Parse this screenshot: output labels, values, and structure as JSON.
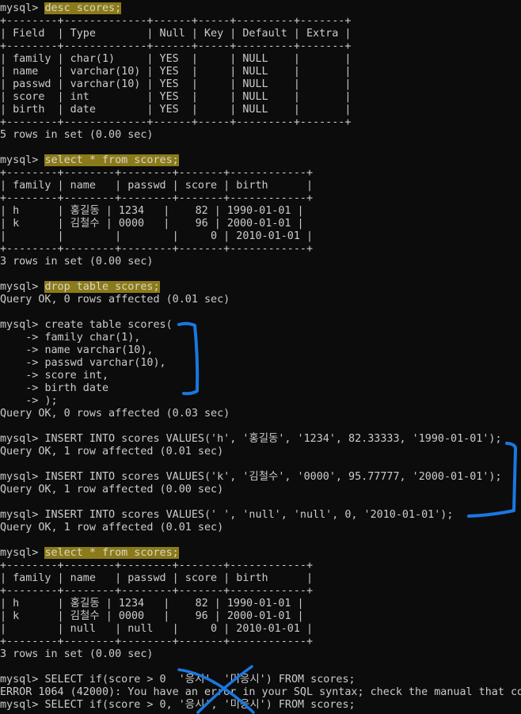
{
  "terminal": {
    "prompt": "mysql> ",
    "cont_prompt": "    -> ",
    "lines": [
      {
        "type": "cmd",
        "text": "desc scores;",
        "highlight": true
      },
      {
        "type": "out",
        "text": "+--------+-------------+------+-----+---------+-------+"
      },
      {
        "type": "out",
        "text": "| Field  | Type        | Null | Key | Default | Extra |"
      },
      {
        "type": "out",
        "text": "+--------+-------------+------+-----+---------+-------+"
      },
      {
        "type": "out",
        "text": "| family | char(1)     | YES  |     | NULL    |       |"
      },
      {
        "type": "out",
        "text": "| name   | varchar(10) | YES  |     | NULL    |       |"
      },
      {
        "type": "out",
        "text": "| passwd | varchar(10) | YES  |     | NULL    |       |"
      },
      {
        "type": "out",
        "text": "| score  | int         | YES  |     | NULL    |       |"
      },
      {
        "type": "out",
        "text": "| birth  | date        | YES  |     | NULL    |       |"
      },
      {
        "type": "out",
        "text": "+--------+-------------+------+-----+---------+-------+"
      },
      {
        "type": "out",
        "text": "5 rows in set (0.00 sec)"
      },
      {
        "type": "blank",
        "text": ""
      },
      {
        "type": "cmd",
        "text": "select * from scores;",
        "highlight": true
      },
      {
        "type": "out",
        "text": "+--------+--------+--------+-------+------------+"
      },
      {
        "type": "out",
        "text": "| family | name   | passwd | score | birth      |"
      },
      {
        "type": "out",
        "text": "+--------+--------+--------+-------+------------+"
      },
      {
        "type": "out",
        "text": "| h      | 홍길동 | 1234   |    82 | 1990-01-01 |"
      },
      {
        "type": "out",
        "text": "| k      | 김철수 | 0000   |    96 | 2000-01-01 |"
      },
      {
        "type": "out",
        "text": "|        |        |        |     0 | 2010-01-01 |"
      },
      {
        "type": "out",
        "text": "+--------+--------+--------+-------+------------+"
      },
      {
        "type": "out",
        "text": "3 rows in set (0.00 sec)"
      },
      {
        "type": "blank",
        "text": ""
      },
      {
        "type": "cmd",
        "text": "drop table scores;",
        "highlight": true
      },
      {
        "type": "out",
        "text": "Query OK, 0 rows affected (0.01 sec)"
      },
      {
        "type": "blank",
        "text": ""
      },
      {
        "type": "cmd",
        "text": "create table scores(",
        "highlight": false
      },
      {
        "type": "cont",
        "text": "family char(1),"
      },
      {
        "type": "cont",
        "text": "name varchar(10),"
      },
      {
        "type": "cont",
        "text": "passwd varchar(10),"
      },
      {
        "type": "cont",
        "text": "score int,"
      },
      {
        "type": "cont",
        "text": "birth date"
      },
      {
        "type": "cont",
        "text": ");"
      },
      {
        "type": "out",
        "text": "Query OK, 0 rows affected (0.03 sec)"
      },
      {
        "type": "blank",
        "text": ""
      },
      {
        "type": "cmd",
        "text": "INSERT INTO scores VALUES('h', '홍길동', '1234', 82.33333, '1990-01-01');",
        "highlight": false
      },
      {
        "type": "out",
        "text": "Query OK, 1 row affected (0.01 sec)"
      },
      {
        "type": "blank",
        "text": ""
      },
      {
        "type": "cmd",
        "text": "INSERT INTO scores VALUES('k', '김철수', '0000', 95.77777, '2000-01-01');",
        "highlight": false
      },
      {
        "type": "out",
        "text": "Query OK, 1 row affected (0.00 sec)"
      },
      {
        "type": "blank",
        "text": ""
      },
      {
        "type": "cmd",
        "text": "INSERT INTO scores VALUES(' ', 'null', 'null', 0, '2010-01-01');",
        "highlight": false
      },
      {
        "type": "out",
        "text": "Query OK, 1 row affected (0.01 sec)"
      },
      {
        "type": "blank",
        "text": ""
      },
      {
        "type": "cmd",
        "text": "select * from scores;",
        "highlight": true
      },
      {
        "type": "out",
        "text": "+--------+--------+--------+-------+------------+"
      },
      {
        "type": "out",
        "text": "| family | name   | passwd | score | birth      |"
      },
      {
        "type": "out",
        "text": "+--------+--------+--------+-------+------------+"
      },
      {
        "type": "out",
        "text": "| h      | 홍길동 | 1234   |    82 | 1990-01-01 |"
      },
      {
        "type": "out",
        "text": "| k      | 김철수 | 0000   |    96 | 2000-01-01 |"
      },
      {
        "type": "out",
        "text": "|        | null   | null   |     0 | 2010-01-01 |"
      },
      {
        "type": "out",
        "text": "+--------+--------+--------+-------+------------+"
      },
      {
        "type": "out",
        "text": "3 rows in set (0.00 sec)"
      },
      {
        "type": "blank",
        "text": ""
      },
      {
        "type": "cmd",
        "text": "SELECT if(score > 0  '응시', '미응시') FROM scores;",
        "highlight": false
      },
      {
        "type": "out",
        "text": "ERROR 1064 (42000): You have an error in your SQL syntax; check the manual that co"
      },
      {
        "type": "cmd",
        "text": "SELECT if(score > 0, '응시', '미응시') FROM scores;",
        "highlight": false
      }
    ]
  },
  "annotations": {
    "color": "#1a78e0",
    "marks": [
      "bracket-create-table",
      "bracket-inserts",
      "x-mark-error"
    ]
  }
}
